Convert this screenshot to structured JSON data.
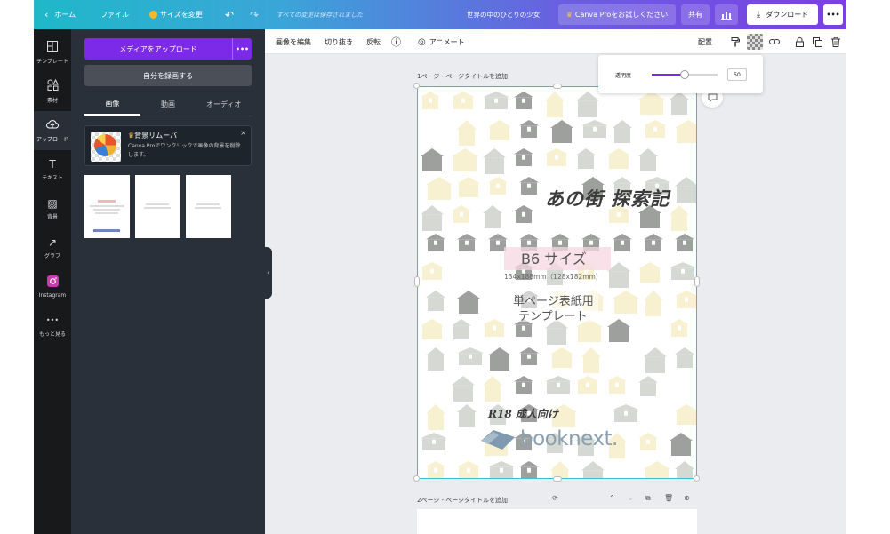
{
  "topbar": {
    "home": "ホーム",
    "file": "ファイル",
    "resize": "サイズを変更",
    "undo_icon": "undo-icon",
    "redo_icon": "redo-icon",
    "save_status": "すべての変更は保存されました",
    "doc_title": "世界の中のひとりの少女",
    "try_pro": "Canva Proをお試しください",
    "share": "共有",
    "insights_icon": "bar-chart-icon",
    "download": "ダウンロード",
    "more": "•••"
  },
  "rail": {
    "items": [
      {
        "label": "テンプレート",
        "icon": "▥"
      },
      {
        "label": "素材",
        "icon": "◇"
      },
      {
        "label": "アップロード",
        "icon": "☁"
      },
      {
        "label": "テキスト",
        "icon": "T"
      },
      {
        "label": "背景",
        "icon": "▨"
      },
      {
        "label": "グラフ",
        "icon": "↗"
      },
      {
        "label": "Instagram",
        "icon": "◎"
      },
      {
        "label": "もっと見る",
        "icon": "•••"
      }
    ]
  },
  "panel": {
    "upload_button": "メディアをアップロード",
    "upload_more": "•••",
    "record_button": "自分を録画する",
    "tabs": [
      "画像",
      "動画",
      "オーディオ"
    ],
    "promo": {
      "title": "背景リムーバ",
      "body": "Canva Proでワンクリックで画像の背景を削除します。",
      "close": "×"
    },
    "collapse_icon": "‹"
  },
  "ctx": {
    "edit_image": "画像を編集",
    "crop": "切り抜き",
    "flip": "反転",
    "info_icon": "ⓘ",
    "animate": "アニメート",
    "position": "配置",
    "paint_icon": "🖌",
    "transparency_icon": "▦",
    "link_icon": "⛓",
    "lock_icon": "🔒",
    "duplicate_icon": "⧉",
    "delete_icon": "🗑"
  },
  "page1": {
    "label": "1ページ - ページタイトルを追加",
    "title": "あの街 探索記",
    "size": "B6 サイズ",
    "dims": "134x188mm（128x182mm）",
    "desc1": "単ページ表紙用",
    "desc2": "テンプレート",
    "rating": "R18 成人向け",
    "brand": "booknext."
  },
  "page2": {
    "label": "2ページ - ページタイトルを追加"
  },
  "popup": {
    "label": "透明度",
    "value": "50",
    "fraction": 0.5
  },
  "colors": {
    "accent": "#7d2ae8",
    "select": "#35c0d4",
    "tile_yellow": "#f6ecc2",
    "tile_gray": "#c9cdc5",
    "tile_dark": "#7c807d"
  }
}
